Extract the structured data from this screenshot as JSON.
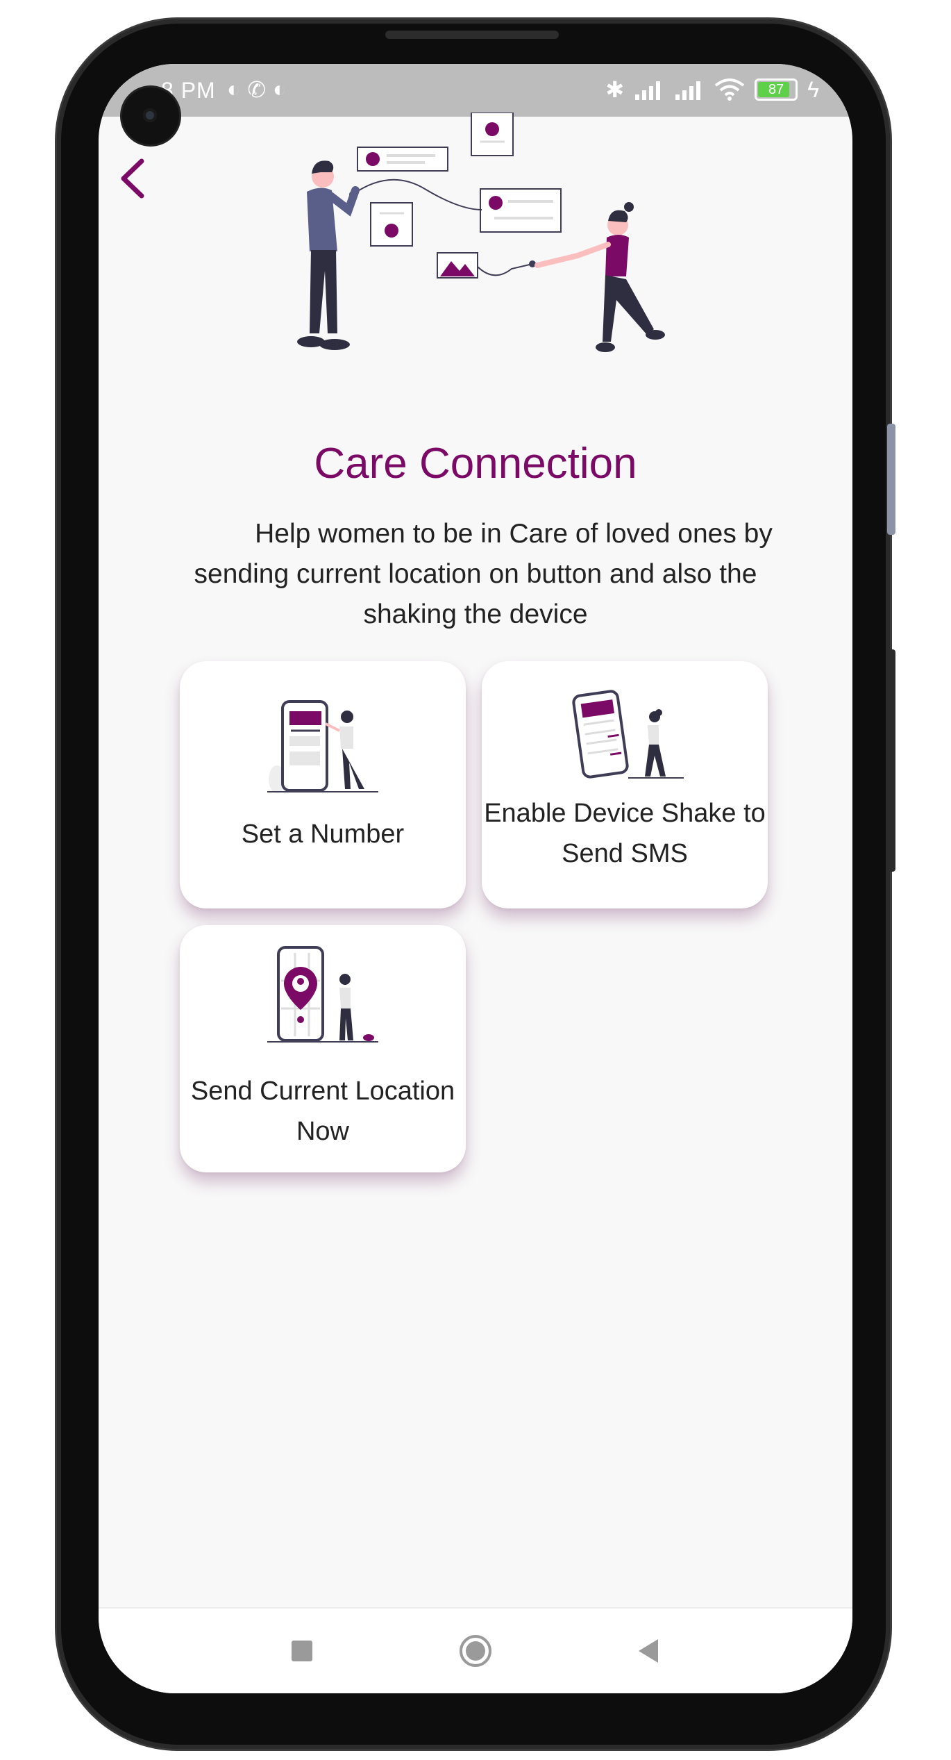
{
  "status_bar": {
    "time": "8 PM",
    "battery_level": "87",
    "icons": [
      "bluetooth-icon",
      "signal-icon",
      "signal-icon",
      "wifi-icon",
      "battery-icon",
      "charging-icon"
    ]
  },
  "header": {
    "back_icon": "chevron-left-icon"
  },
  "main": {
    "title": "Care Connection",
    "description": "Help women to be in Care of loved ones by sending current location on button and also the shaking the device"
  },
  "cards": [
    {
      "label": "Set a Number",
      "icon": "phone-contact-illustration"
    },
    {
      "label": "Enable Device Shake to Send SMS",
      "icon": "phone-shake-illustration"
    },
    {
      "label": "Send Current Location Now",
      "icon": "location-pin-illustration"
    }
  ],
  "colors": {
    "accent": "#7b0a66",
    "background": "#f8f8f8",
    "card": "#ffffff",
    "status_bar": "#bcbcbc"
  },
  "navbar": {
    "icons": [
      "recents-square-icon",
      "home-circle-icon",
      "back-triangle-icon"
    ]
  }
}
